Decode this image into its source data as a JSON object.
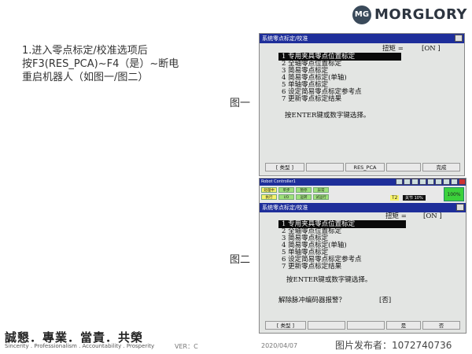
{
  "brand": {
    "badge": "MG",
    "name": "MORGLORY"
  },
  "instructions": {
    "line1": "1.进入零点标定/校准选项后",
    "line2": "按F3(RES_PCA)~F4（是）~断电",
    "line3": "重启机器人（如图一/图二）"
  },
  "figure_labels": {
    "fig1": "图一",
    "fig2": "图二"
  },
  "screen1": {
    "title": "系统零点标定/校准",
    "torque_label": "扭矩 =",
    "torque_value": "[ON ]",
    "options": [
      "1 专用夹具零点位置标定",
      "2 全轴零点位置标定",
      "3 简易零点标定",
      "4 简易零点标定(单轴)",
      "5 单轴零点标定",
      "6 设定简易零点标定参考点",
      "7 更新零点标定结果"
    ],
    "prompt": "按ENTER键或数字键选择。",
    "fkeys": [
      "[ 类型 ]",
      "RES_PCA",
      "完成"
    ]
  },
  "screen2": {
    "window_title": "Robot Controller1",
    "status_leds": [
      "处理中",
      "单步",
      "暂停",
      "异常",
      "执行",
      "I/O",
      "运转",
      "试运行"
    ],
    "mode": "T2",
    "stop_label": "关节 10%",
    "percent": "100%",
    "title": "系统零点标定/校准",
    "torque_label": "扭矩 =",
    "torque_value": "[ON ]",
    "options": [
      "1 专用夹具零点位置标定",
      "2 全轴零点位置标定",
      "3 简易零点标定",
      "4 简易零点标定(单轴)",
      "5 单轴零点标定",
      "6 设定简易零点标定参考点",
      "7 更新零点标定结果"
    ],
    "prompt": "按ENTER键或数字键选择。",
    "question": "解除脉冲编码器报警？",
    "answer": "[否]",
    "fkeys": [
      "[ 类型 ]",
      "是",
      "否"
    ]
  },
  "footer": {
    "motto": "誠懇．專業．當責．共榮",
    "motto_en": "Sincerity . Professionalism . Accountability . Prosperity",
    "version": "VER：C",
    "date": "2020/04/07",
    "watermark": "图片发布者：107274073​6"
  }
}
